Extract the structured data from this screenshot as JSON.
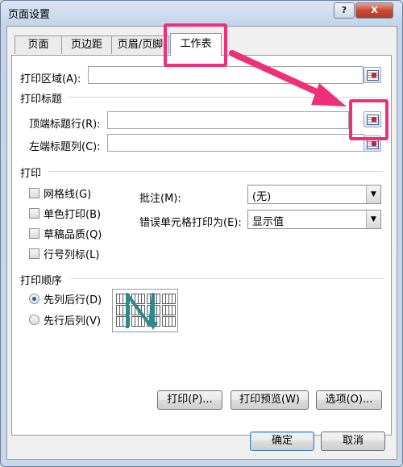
{
  "window": {
    "title": "页面设置",
    "help_label": "?",
    "close_label": "X"
  },
  "tabs": [
    "页面",
    "页边距",
    "页眉/页脚",
    "工作表"
  ],
  "print_area": {
    "label": "打印区域(A):",
    "value": ""
  },
  "print_titles": {
    "heading": "打印标题",
    "rows_label": "顶端标题行(R):",
    "cols_label": "左端标题列(C):"
  },
  "print": {
    "heading": "打印",
    "checkboxes": [
      "网格线(G)",
      "单色打印(B)",
      "草稿品质(Q)",
      "行号列标(L)"
    ],
    "comments_label": "批注(M):",
    "comments_value": "(无)",
    "errors_label": "错误单元格打印为(E):",
    "errors_value": "显示值"
  },
  "order": {
    "heading": "打印顺序",
    "options": [
      "先列后行(D)",
      "先行后列(V)"
    ],
    "selected": 0
  },
  "buttons": {
    "print": "打印(P)...",
    "preview": "打印预览(W)",
    "options": "选项(O)...",
    "ok": "确定",
    "cancel": "取消"
  },
  "colors": {
    "highlight": "#ee2f7a",
    "arrow_color": "#2a8a8c"
  }
}
